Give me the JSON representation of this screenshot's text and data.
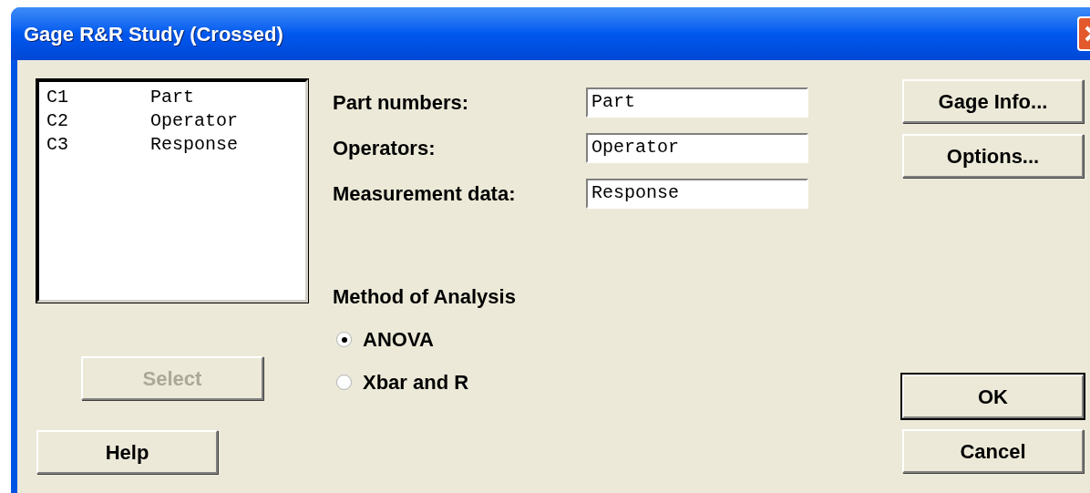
{
  "window": {
    "title": "Gage R&R Study (Crossed)"
  },
  "variables": [
    {
      "column": "C1",
      "name": "Part"
    },
    {
      "column": "C2",
      "name": "Operator"
    },
    {
      "column": "C3",
      "name": "Response"
    }
  ],
  "select_button": {
    "label": "Select",
    "disabled": true
  },
  "help_button": {
    "label": "Help"
  },
  "fields": [
    {
      "label": "Part numbers:",
      "value": "Part"
    },
    {
      "label": "Operators:",
      "value": "Operator"
    },
    {
      "label": "Measurement data:",
      "value": "Response"
    }
  ],
  "method": {
    "label": "Method of Analysis",
    "options": [
      {
        "label": "ANOVA",
        "selected": true
      },
      {
        "label": "Xbar and R",
        "selected": false
      }
    ]
  },
  "side_buttons": [
    {
      "label": "Gage Info...",
      "default": false
    },
    {
      "label": "Options...",
      "default": false
    }
  ],
  "bottom_buttons": [
    {
      "label": "OK",
      "default": true
    },
    {
      "label": "Cancel",
      "default": false
    }
  ]
}
